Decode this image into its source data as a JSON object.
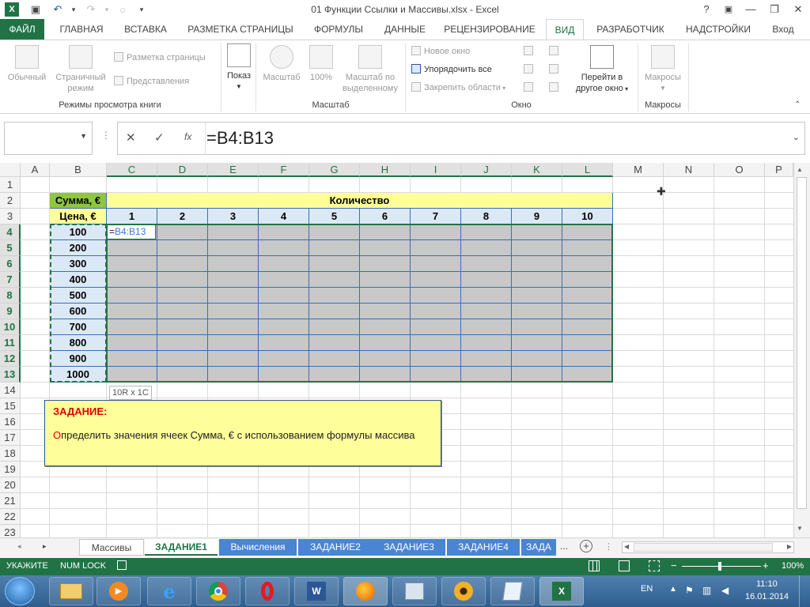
{
  "titlebar": {
    "title": "01 Функции Ссылки и Массивы.xlsx - Excel",
    "help": "?",
    "min": "—",
    "max": "❐",
    "close": "✕"
  },
  "ribbon_tabs": [
    "ФАЙЛ",
    "ГЛАВНАЯ",
    "ВСТАВКА",
    "РАЗМЕТКА СТРАНИЦЫ",
    "ФОРМУЛЫ",
    "ДАННЫЕ",
    "РЕЦЕНЗИРОВАНИЕ",
    "ВИД",
    "РАЗРАБОТЧИК",
    "НАДСТРОЙКИ",
    "Вход"
  ],
  "ribbon": {
    "views": {
      "normal": "Обычный",
      "page1": "Страничный",
      "page2": "режим",
      "layout": "Разметка страницы",
      "custom": "Представления",
      "group": "Режимы просмотра книги"
    },
    "show": {
      "label": "Показ"
    },
    "zoom": {
      "zoom": "Масштаб",
      "z100": "100%",
      "sel1": "Масштаб по",
      "sel2": "выделенному",
      "group": "Масштаб"
    },
    "window": {
      "new": "Новое окно",
      "arrange": "Упорядочить все",
      "freeze": "Закрепить области",
      "switch1": "Перейти в",
      "switch2": "другое окно",
      "group": "Окно"
    },
    "macros": {
      "label": "Макросы",
      "group": "Макросы"
    }
  },
  "formula_bar": {
    "name_box": "",
    "cancel": "✕",
    "enter": "✓",
    "fx": "fx",
    "formula": "=B4:B13"
  },
  "columns": [
    "A",
    "B",
    "C",
    "D",
    "E",
    "F",
    "G",
    "H",
    "I",
    "J",
    "K",
    "L",
    "M",
    "N",
    "O",
    "P"
  ],
  "rows": [
    "1",
    "2",
    "3",
    "4",
    "5",
    "6",
    "7",
    "8",
    "9",
    "10",
    "11",
    "12",
    "13",
    "14",
    "15",
    "16",
    "17",
    "18",
    "19",
    "20",
    "21",
    "22",
    "23"
  ],
  "table": {
    "sum_header": "Сумма, €",
    "qty_header": "Количество",
    "price_header": "Цена, €",
    "qty": [
      "1",
      "2",
      "3",
      "4",
      "5",
      "6",
      "7",
      "8",
      "9",
      "10"
    ],
    "prices": [
      "100",
      "200",
      "300",
      "400",
      "500",
      "600",
      "700",
      "800",
      "900",
      "1000"
    ],
    "edit_text": "=B4:B13",
    "size_tip": "10R x 1C"
  },
  "note": {
    "title": "ЗАДАНИЕ:",
    "first_letter": "О",
    "body": "пределить значения ячеек Сумма, € с использованием формулы массива"
  },
  "sheets": [
    {
      "label": "Массивы",
      "style": "white"
    },
    {
      "label": "ЗАДАНИЕ1",
      "style": "active"
    },
    {
      "label": "Вычисления",
      "style": "blue"
    },
    {
      "label": "ЗАДАНИЕ2",
      "style": "blue"
    },
    {
      "label": "ЗАДАНИЕ3",
      "style": "blue"
    },
    {
      "label": "ЗАДАНИЕ4",
      "style": "blue"
    },
    {
      "label": "ЗАДА",
      "style": "blue"
    }
  ],
  "sheet_more": "...",
  "status": {
    "mode": "УКАЖИТЕ",
    "numlock": "NUM LOCK",
    "zoom": "100%"
  },
  "taskbar": {
    "lang": "EN",
    "time": "11:10",
    "date": "16.01.2014"
  },
  "colors": {
    "excel_green": "#217346",
    "header_green": "#8ec641",
    "header_yellow": "#fefe9a",
    "header_blue": "#dbe9f6",
    "body_gray": "#c8c8c8",
    "note_red": "#e00000"
  }
}
